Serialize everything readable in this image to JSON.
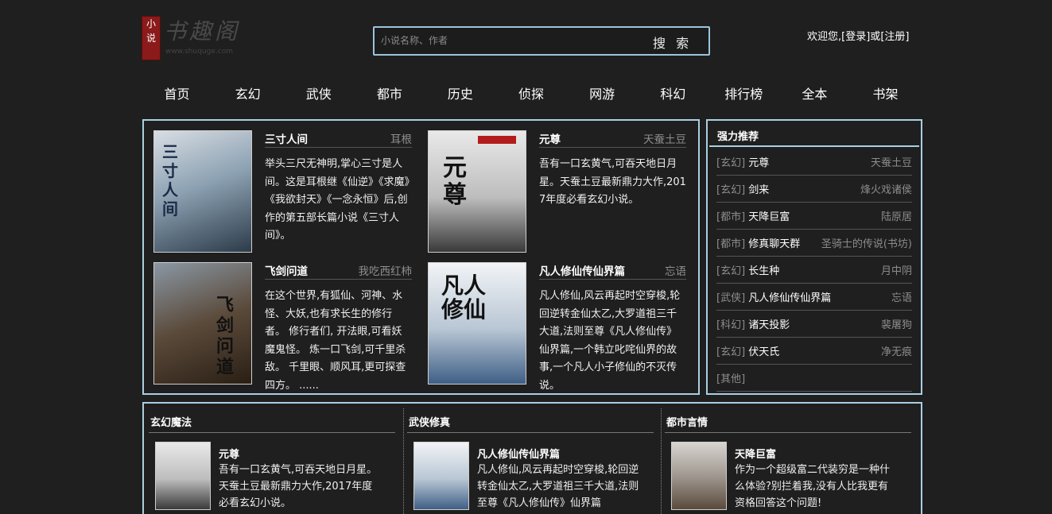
{
  "header": {
    "logo_seal": "小说",
    "logo_text": "书趣阁",
    "logo_url": "www.shuquge.com",
    "search_placeholder": "小说名称、作者",
    "search_button": "搜 索",
    "welcome": "欢迎您,",
    "login": "[登录]",
    "or": "或",
    "register": "[注册]"
  },
  "nav": [
    "首页",
    "玄幻",
    "武侠",
    "都市",
    "历史",
    "侦探",
    "网游",
    "科幻",
    "排行榜",
    "全本",
    "书架"
  ],
  "featured": [
    {
      "title": "三寸人间",
      "author": "耳根",
      "desc": "举头三尺无神明,掌心三寸是人间。这是耳根继《仙逆》《求魔》《我欲封天》《一念永恒》后,创作的第五部长篇小说《三寸人间》。",
      "cover_text": "三寸人间"
    },
    {
      "title": "元尊",
      "author": "天蚕土豆",
      "desc": "吾有一口玄黄气,可吞天地日月星。天蚕土豆最新鼎力大作,2017年度必看玄幻小说。",
      "cover_text": "元尊"
    },
    {
      "title": "飞剑问道",
      "author": "我吃西红柿",
      "desc": "在这个世界,有狐仙、河神、水怪、大妖,也有求长生的修行者。 修行者们, 开法眼,可看妖魔鬼怪。 炼一口飞剑,可千里杀敌。 千里眼、顺风耳,更可探查四方。 ......",
      "cover_text": "飞剑问道"
    },
    {
      "title": "凡人修仙传仙界篇",
      "author": "忘语",
      "desc": "凡人修仙,风云再起时空穿梭,轮回逆转金仙太乙,大罗道祖三千大道,法则至尊《凡人修仙传》仙界篇,一个韩立叱咤仙界的故事,一个凡人小子修仙的不灭传说。",
      "cover_text": "凡人修仙"
    }
  ],
  "rank": {
    "title": "强力推荐",
    "items": [
      {
        "cat": "[玄幻]",
        "name": "元尊",
        "author": "天蚕土豆"
      },
      {
        "cat": "[玄幻]",
        "name": "剑来",
        "author": "烽火戏诸侯"
      },
      {
        "cat": "[都市]",
        "name": "天降巨富",
        "author": "陆原居"
      },
      {
        "cat": "[都市]",
        "name": "修真聊天群",
        "author": "圣骑士的传说(书坊)"
      },
      {
        "cat": "[玄幻]",
        "name": "长生种",
        "author": "月中阴"
      },
      {
        "cat": "[武侠]",
        "name": "凡人修仙传仙界篇",
        "author": "忘语"
      },
      {
        "cat": "[科幻]",
        "name": "诸天投影",
        "author": "裴屠狗"
      },
      {
        "cat": "[玄幻]",
        "name": "伏天氏",
        "author": "净无痕"
      },
      {
        "cat": "[其他]",
        "name": "",
        "author": ""
      }
    ]
  },
  "categories": [
    {
      "title": "玄幻魔法",
      "book": "元尊",
      "desc": "吾有一口玄黄气,可吞天地日月星。天蚕土豆最新鼎力大作,2017年度必看玄幻小说。"
    },
    {
      "title": "武侠修真",
      "book": "凡人修仙传仙界篇",
      "desc": "凡人修仙,风云再起时空穿梭,轮回逆转金仙太乙,大罗道祖三千大道,法则至尊《凡人修仙传》仙界篇"
    },
    {
      "title": "都市言情",
      "book": "天降巨富",
      "desc": "作为一个超级富二代装穷是一种什么体验?别拦着我,没有人比我更有资格回答这个问题!"
    }
  ]
}
